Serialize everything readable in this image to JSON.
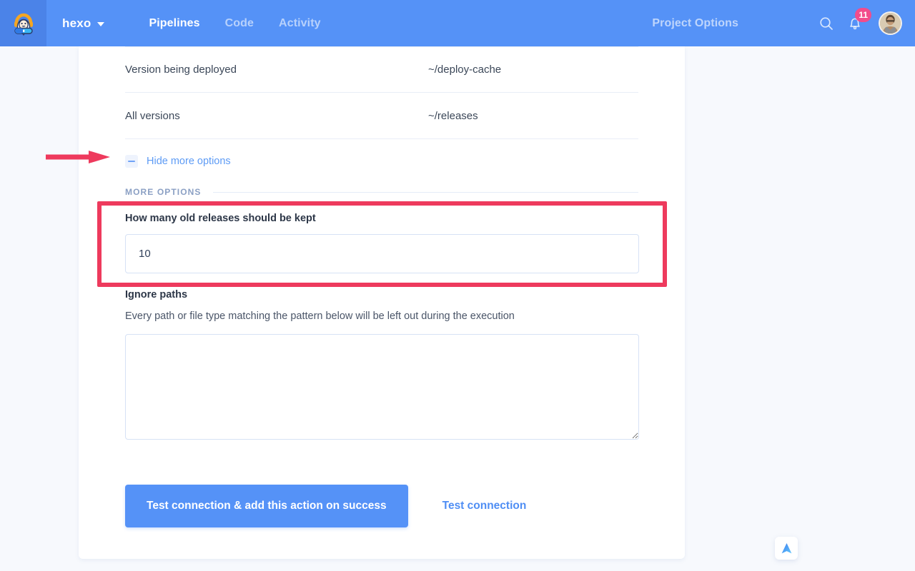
{
  "topbar": {
    "logo_icon": "buddy-astronaut-logo",
    "project_name": "hexo",
    "caret_icon": "chevron-down-icon",
    "nav": [
      {
        "label": "Pipelines",
        "active": true
      },
      {
        "label": "Code",
        "active": false
      },
      {
        "label": "Activity",
        "active": false
      }
    ],
    "project_options_label": "Project Options",
    "search_icon": "search-icon",
    "bell_icon": "bell-icon",
    "notification_count": "11",
    "avatar_icon": "user-avatar",
    "accent_color": "#5592f7",
    "logo_tile_color": "#4b83e8",
    "badge_color": "#f24c8c"
  },
  "paths_table": {
    "rows": [
      {
        "label": "Version being deployed",
        "value": "~/deploy-cache"
      },
      {
        "label": "All versions",
        "value": "~/releases"
      }
    ]
  },
  "toggle_more": {
    "icon": "minus-icon",
    "label": "Hide more options"
  },
  "more_options": {
    "section_label": "More options",
    "releases_kept": {
      "label": "How many old releases should be kept",
      "value": "10",
      "placeholder": ""
    },
    "ignore_paths": {
      "label": "Ignore paths",
      "hint": "Every path or file type matching the pattern below will be left out during the execution",
      "value": "",
      "placeholder": ""
    }
  },
  "actions": {
    "primary_label": "Test connection & add this action on success",
    "secondary_label": "Test connection"
  },
  "annotations": {
    "highlight_color": "#ee3a5d",
    "arrow_icon": "red-arrow-right",
    "box_icon": "red-highlight-box"
  },
  "fab": {
    "icon": "scroll-up-arrow-icon"
  }
}
